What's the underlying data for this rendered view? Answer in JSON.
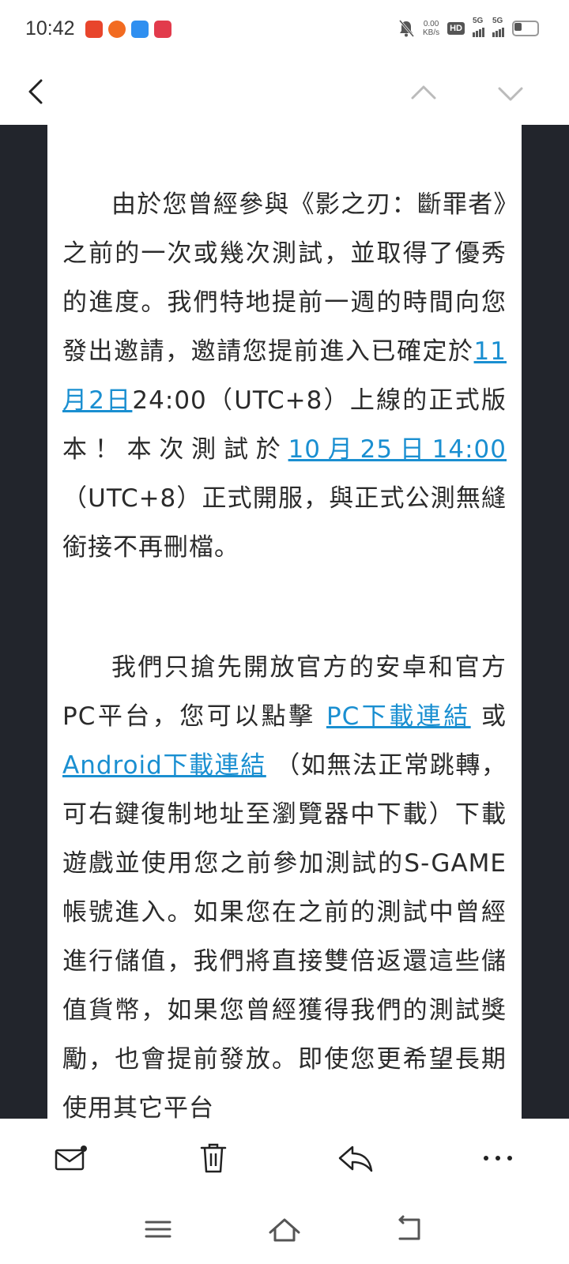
{
  "status_bar": {
    "time": "10:42",
    "net_speed_value": "0.00",
    "net_speed_unit": "KB/s",
    "hd_label": "HD",
    "sim1_label": "5G",
    "sim2_label": "5G"
  },
  "toolbar": {
    "back_icon": "chevron-left-icon",
    "prev_icon": "chevron-up-icon",
    "next_icon": "chevron-down-icon"
  },
  "email_body": {
    "para1": {
      "text_a": "由於您曾經參與《影之刃：斷罪者》之前的一次或幾次測試，並取得了優秀的進度。我們特地提前一週的時間向您發出邀請，邀請您提前進入已確定於",
      "date_link": "11月2日",
      "text_b": "24:00（UTC+8）上線的正式版本！本次測試於",
      "open_link": "10月25日14:00",
      "text_c": "（UTC+8）正式開服，與正式公測無縫銜接不再刪檔。"
    },
    "para2": {
      "text_a": "我們只搶先開放官方的安卓和官方PC平台，您可以點擊 ",
      "pc_link": "PC下載連結",
      "text_b": " 或 ",
      "android_link": "Android下載連結",
      "text_c": " （如無法正常跳轉，可右鍵復制地址至瀏覽器中下載）下載遊戲並使用您之前參加測試的S-GAME帳號進入。如果您在之前的測試中曾經進行儲值，我們將直接雙倍返還這些儲值貨幣，如果您曾經獲得我們的測試獎勵，也會提前發放。即使您更希望長期使用其它平台"
    }
  },
  "action_bar": {
    "mail_icon": "mail-unread-icon",
    "delete_icon": "trash-icon",
    "reply_icon": "reply-icon",
    "more_icon": "more-horizontal-icon"
  },
  "nav_bar": {
    "menu_icon": "menu-icon",
    "home_icon": "home-icon",
    "back_icon": "back-icon"
  }
}
